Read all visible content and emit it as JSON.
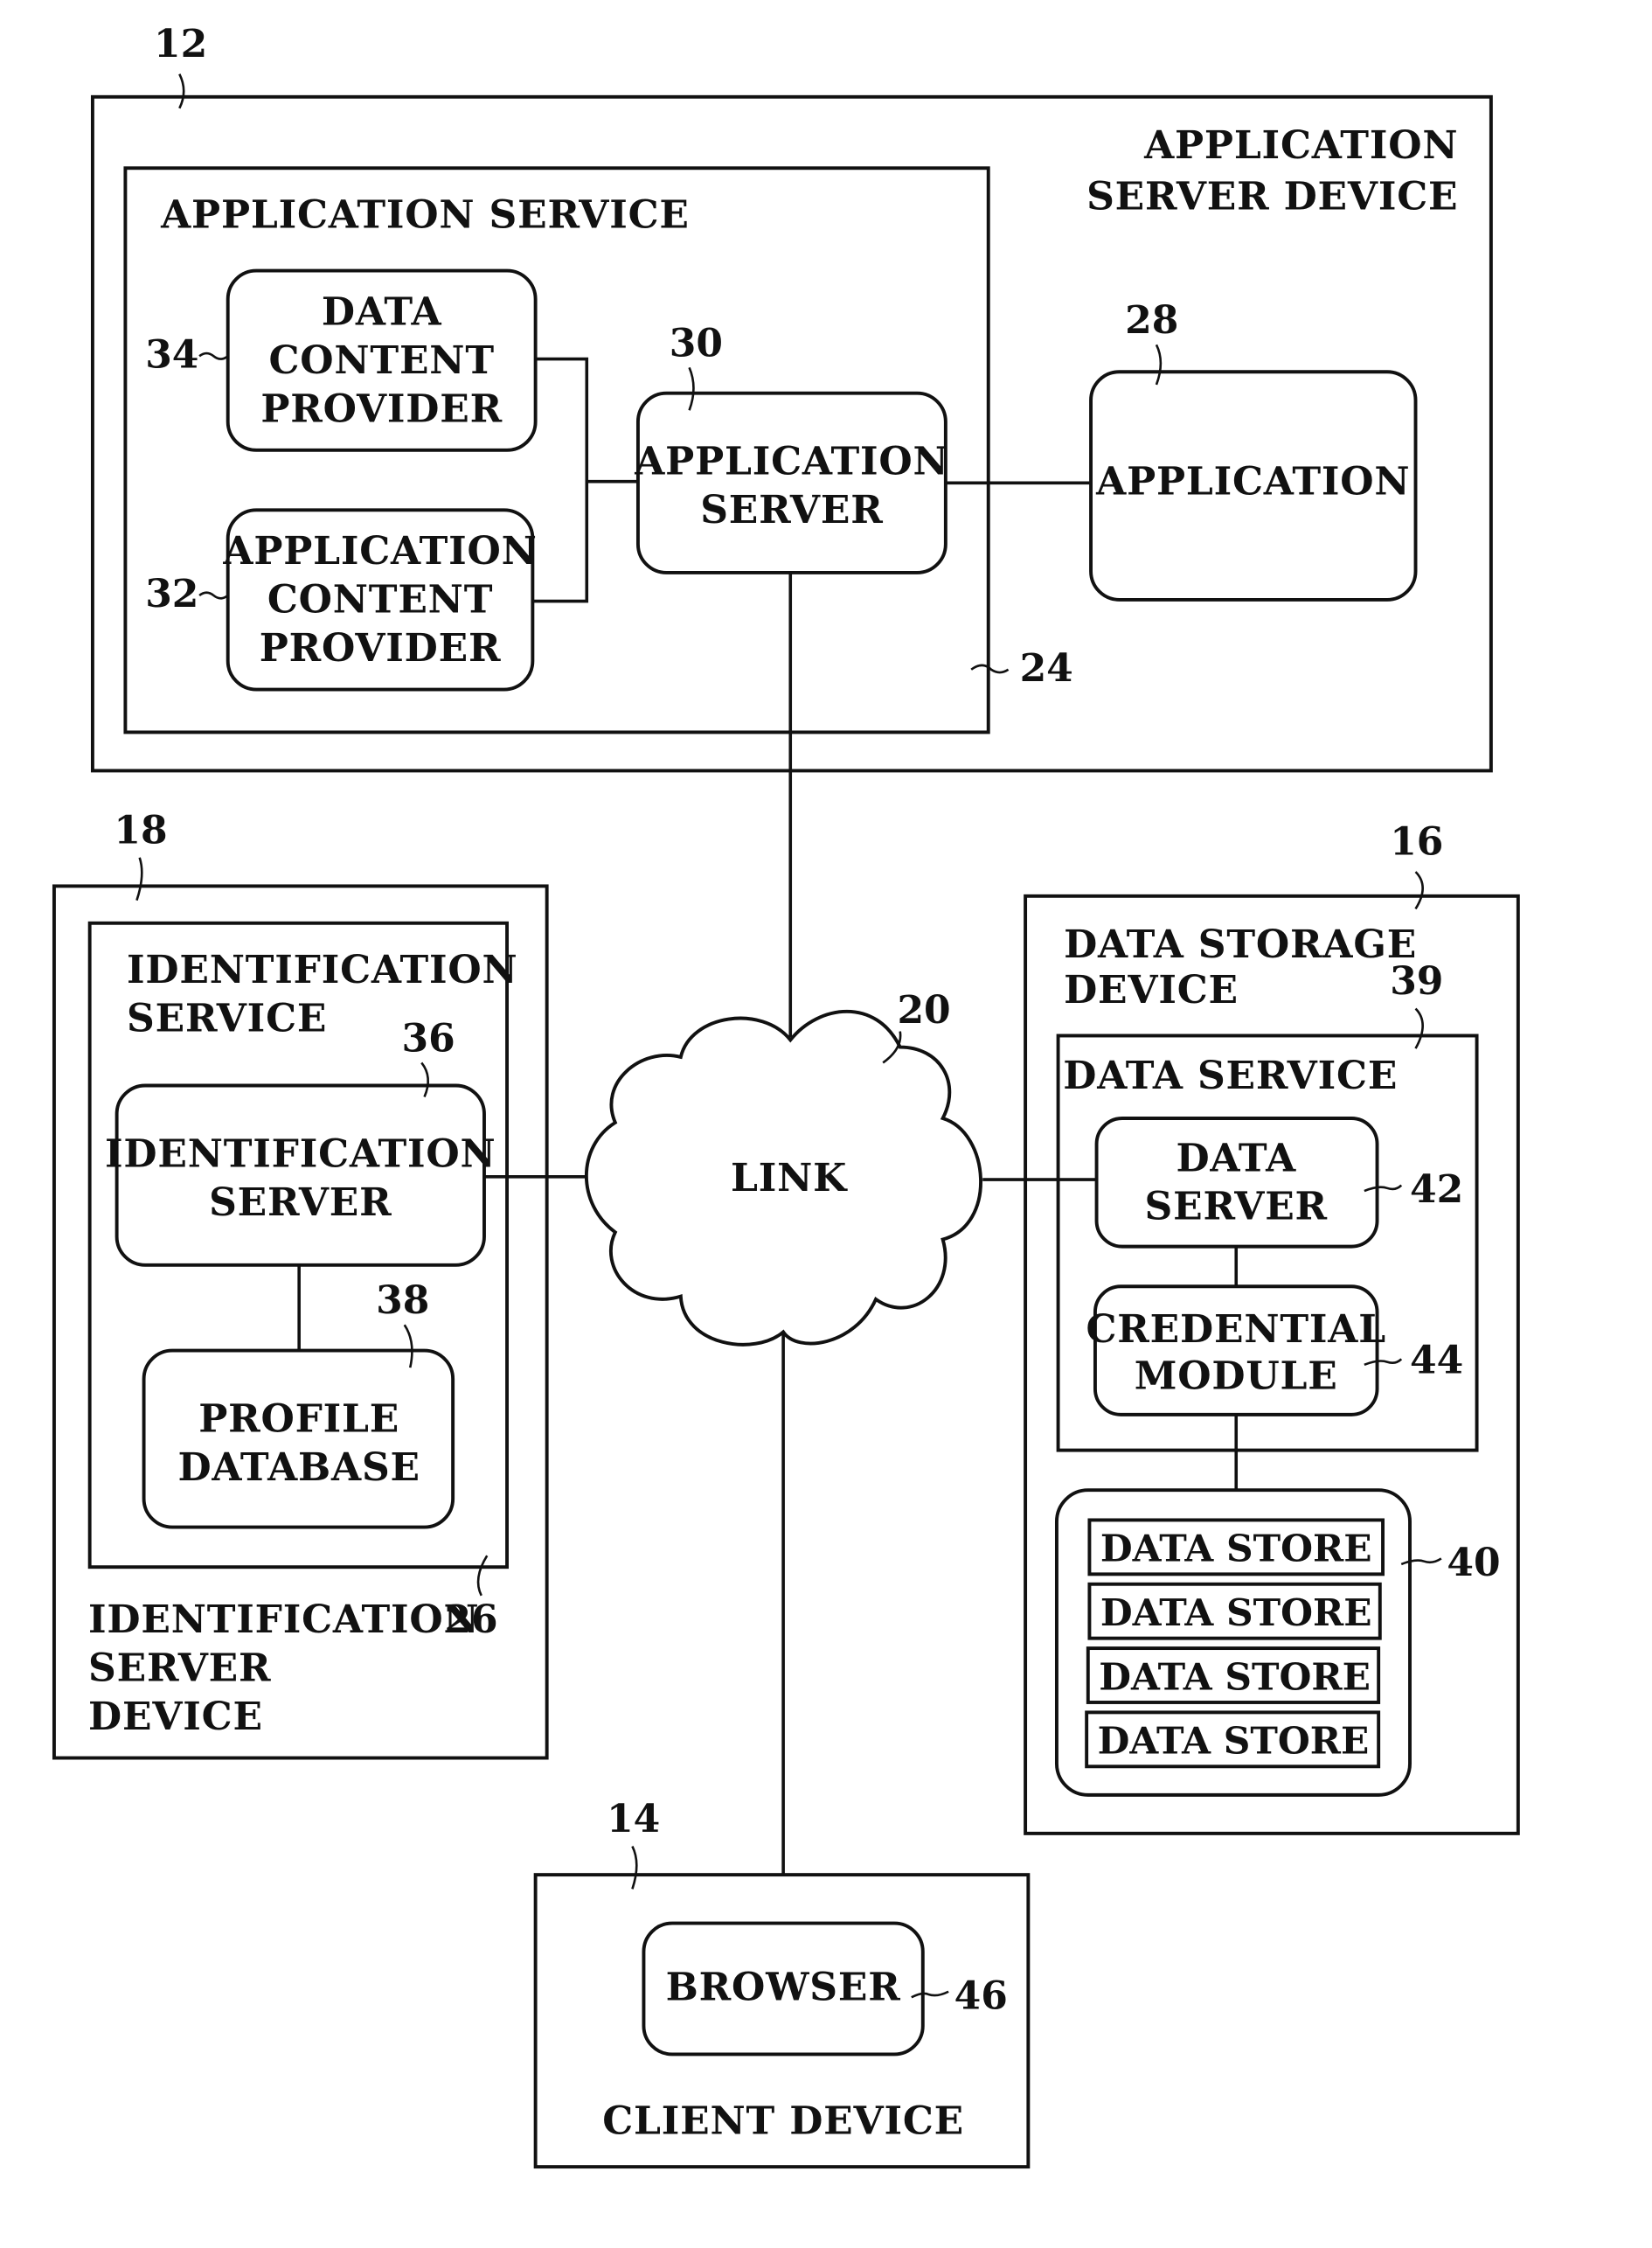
{
  "diagram": {
    "application_server_device": {
      "ref": "12",
      "label_lines": [
        "APPLICATION",
        "SERVER DEVICE"
      ],
      "application_service": {
        "ref": "24",
        "label": "APPLICATION SERVICE",
        "data_content_provider": {
          "ref": "34",
          "label_lines": [
            "DATA",
            "CONTENT",
            "PROVIDER"
          ]
        },
        "application_content_provider": {
          "ref": "32",
          "label_lines": [
            "APPLICATION",
            "CONTENT",
            "PROVIDER"
          ]
        },
        "application_server": {
          "ref": "30",
          "label_lines": [
            "APPLICATION",
            "SERVER"
          ]
        }
      },
      "application": {
        "ref": "28",
        "label": "APPLICATION"
      }
    },
    "identification_server_device": {
      "ref": "18",
      "label_lines": [
        "IDENTIFICATION",
        "SERVER",
        "DEVICE"
      ],
      "identification_service": {
        "ref": "26",
        "label_lines": [
          "IDENTIFICATION",
          "SERVICE"
        ],
        "identification_server": {
          "ref": "36",
          "label_lines": [
            "IDENTIFICATION",
            "SERVER"
          ]
        },
        "profile_database": {
          "ref": "38",
          "label_lines": [
            "PROFILE",
            "DATABASE"
          ]
        }
      }
    },
    "link": {
      "ref": "20",
      "label": "LINK"
    },
    "data_storage_device": {
      "ref": "16",
      "label_lines": [
        "DATA STORAGE",
        "DEVICE"
      ],
      "data_service": {
        "ref": "39",
        "label": "DATA SERVICE",
        "data_server": {
          "ref": "42",
          "label_lines": [
            "DATA",
            "SERVER"
          ]
        },
        "credential_module": {
          "ref": "44",
          "label_lines": [
            "CREDENTIAL",
            "MODULE"
          ]
        }
      },
      "data_stores": {
        "ref": "40",
        "items": [
          "DATA STORE",
          "DATA STORE",
          "DATA STORE",
          "DATA STORE"
        ]
      }
    },
    "client_device": {
      "ref": "14",
      "label": "CLIENT DEVICE",
      "browser": {
        "ref": "46",
        "label": "BROWSER"
      }
    }
  }
}
